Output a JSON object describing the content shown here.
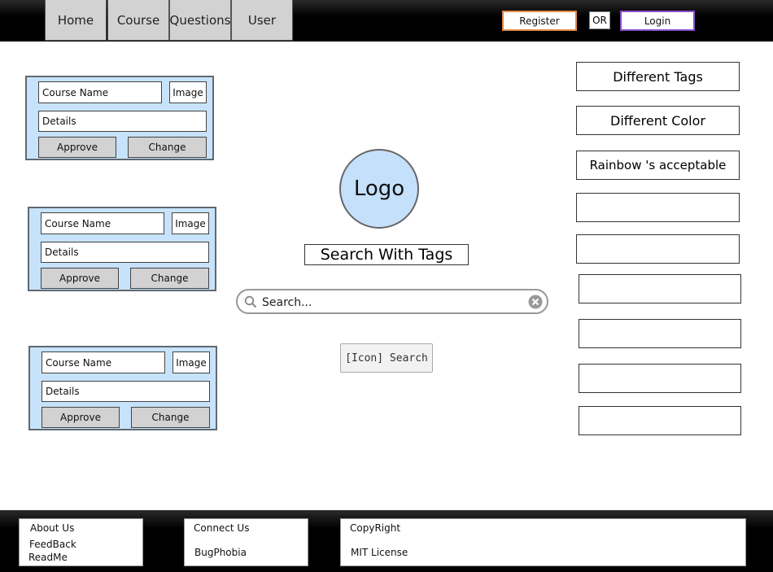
{
  "nav": {
    "tabs": [
      {
        "label": "Home"
      },
      {
        "label": "Course"
      },
      {
        "label": "Questions"
      },
      {
        "label": "User"
      }
    ],
    "register_label": "Register",
    "or_label": "OR",
    "login_label": "Login"
  },
  "courses": [
    {
      "name": "Course Name",
      "image": "Image",
      "details": "Details",
      "approve": "Approve",
      "change": "Change"
    },
    {
      "name": "Course Name",
      "image": "Image",
      "details": "Details",
      "approve": "Approve",
      "change": "Change"
    },
    {
      "name": "Course Name",
      "image": "Image",
      "details": "Details",
      "approve": "Approve",
      "change": "Change"
    }
  ],
  "center": {
    "logo": "Logo",
    "search_tags_label": "Search With Tags",
    "search_placeholder": "Search...",
    "search_button": "[Icon] Search"
  },
  "tags": [
    {
      "label": "Different Tags"
    },
    {
      "label": "Different Color"
    },
    {
      "label": "Rainbow 's acceptable"
    },
    {
      "label": ""
    },
    {
      "label": ""
    },
    {
      "label": ""
    },
    {
      "label": ""
    },
    {
      "label": ""
    },
    {
      "label": ""
    }
  ],
  "footer": {
    "about_us": "About Us",
    "feedback": "FeedBack",
    "readme": "ReadMe",
    "connect_us": "Connect Us",
    "bugphobia": "BugPhobia",
    "copyright": "CopyRight",
    "license": "MIT License"
  },
  "colors": {
    "register_border": "#e08a4a",
    "login_border": "#8a4fc9",
    "card_fill": "#c7e3fb"
  }
}
